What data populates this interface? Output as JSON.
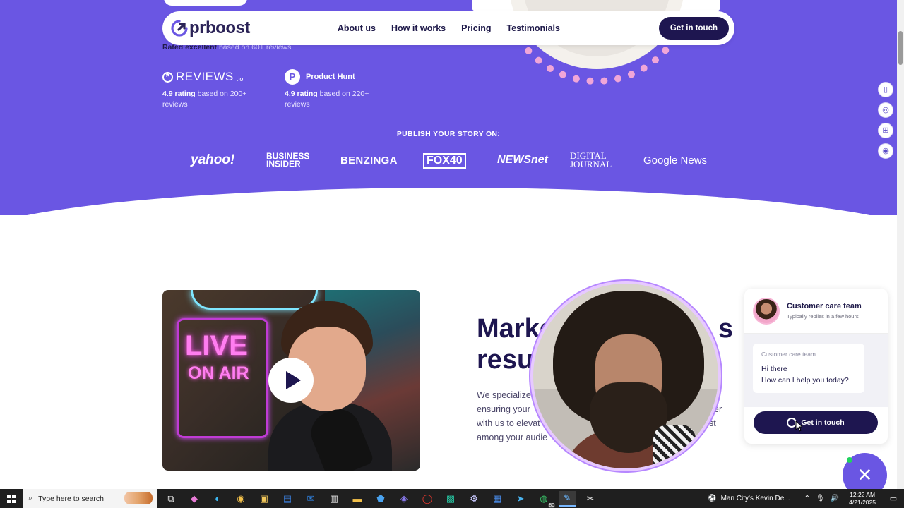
{
  "nav": {
    "logo_text": "prboost",
    "links": [
      "About us",
      "How it works",
      "Pricing",
      "Testimonials"
    ],
    "cta_label": "Get in touch"
  },
  "hero": {
    "rated_excellent": "Rated excellent",
    "rated_based": "based on 60+ reviews",
    "ratings": [
      {
        "brand": "REVIEWS",
        "brand_suffix": ".io",
        "rating": "4.9 rating",
        "desc": "based on 200+ reviews"
      },
      {
        "brand": "Product Hunt",
        "badge": "P",
        "rating": "4.9 rating",
        "desc": "based on 220+ reviews"
      }
    ],
    "publish_title": "PUBLISH YOUR STORY ON:",
    "press": {
      "yahoo": "yahoo!",
      "business_insider_1": "BUSINESS",
      "business_insider_2": "INSIDER",
      "benzinga": "BENZINGA",
      "fox40": "FOX40",
      "newsnet": "NEWSnet",
      "digital_journal_1": "DIGITAL",
      "digital_journal_2": "JOURNAL",
      "google_news": "Google News"
    }
  },
  "video": {
    "neon_live": "LIVE",
    "neon_on_air": "ON AIR"
  },
  "section": {
    "headline_line1": "Marke",
    "headline_line2": "resul",
    "headline_tail": "s",
    "body_line1": "We specialize",
    "body_line2": "ensuring your",
    "body_line2_tail": "er",
    "body_line3": "with us to elevat",
    "body_line3_tail": "ust",
    "body_line4": "among your audie"
  },
  "chat": {
    "team_name": "Customer care team",
    "replies_note": "Typically replies in a few hours",
    "bubble_from": "Customer care team",
    "message_line1": "Hi there",
    "message_line2": "How can I help you today?",
    "cta_label": "Get in touch",
    "close_glyph": "✕"
  },
  "taskbar": {
    "search_placeholder": "Type here to search",
    "news_text": "Man City's Kevin De...",
    "time": "12:22 AM",
    "date": "4/21/2025",
    "whatsapp_badge": "80"
  },
  "colors": {
    "hero_bg": "#6a56e3",
    "dark_navy": "#1e1650",
    "white": "#ffffff"
  }
}
